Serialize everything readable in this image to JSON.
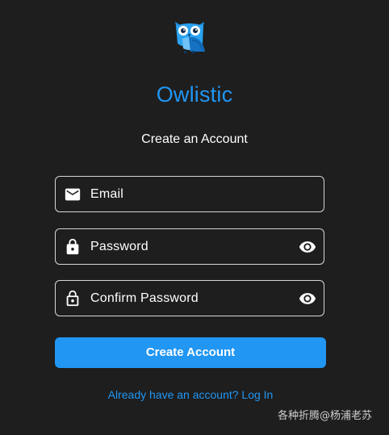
{
  "app": {
    "title": "Owlistic",
    "subtitle": "Create an Account"
  },
  "form": {
    "email": {
      "label": "Email",
      "icon": "mail-icon"
    },
    "password": {
      "label": "Password",
      "icon": "lock-icon",
      "toggle_icon": "eye-icon"
    },
    "confirm_password": {
      "label": "Confirm Password",
      "icon": "lock-icon",
      "toggle_icon": "eye-icon"
    },
    "submit_label": "Create Account"
  },
  "footer": {
    "login_link": "Already have an account? Log In"
  },
  "watermark": {
    "text": "各种折腾@杨浦老苏"
  },
  "colors": {
    "background": "#1e1e1e",
    "accent": "#2196f3",
    "field_border": "#d6d6d6",
    "text": "#ffffff"
  }
}
